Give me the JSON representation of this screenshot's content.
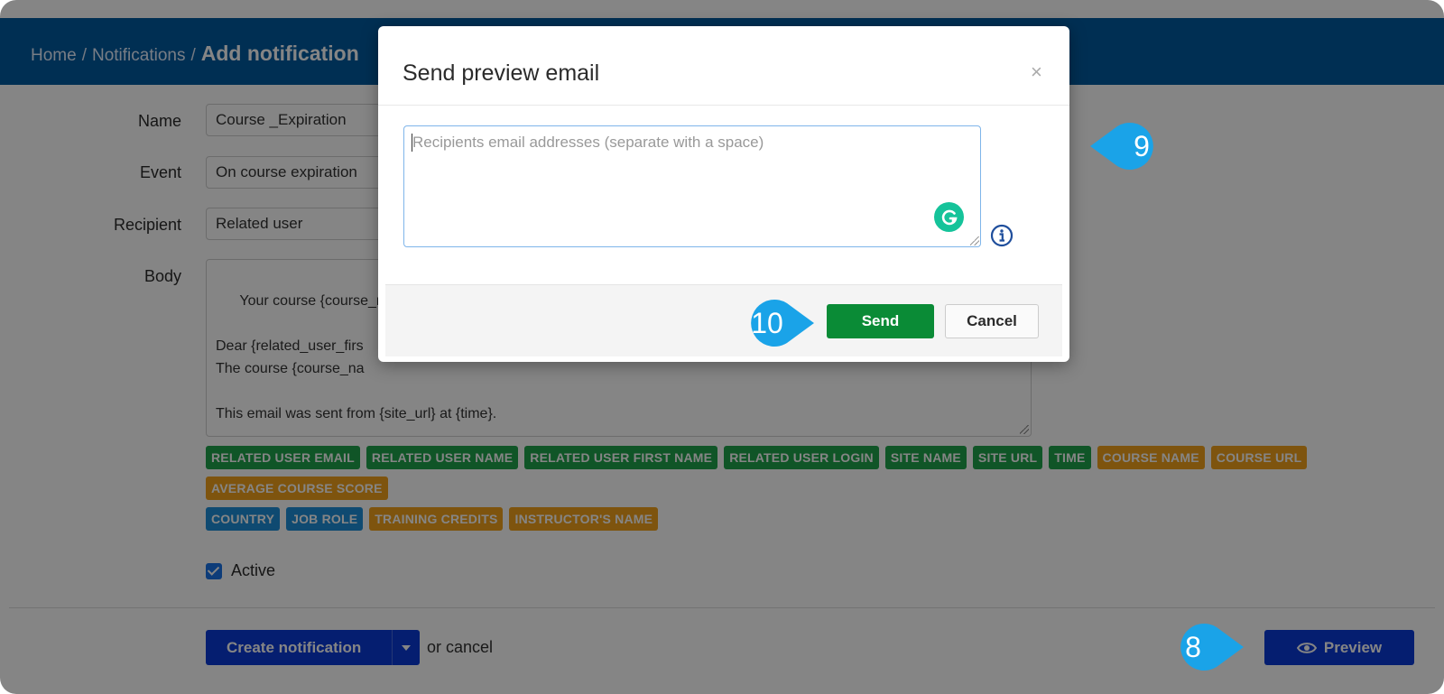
{
  "breadcrumb": {
    "home": "Home",
    "sep1": "/",
    "notifications": "Notifications",
    "sep2": "/",
    "current": "Add notification"
  },
  "form": {
    "name_label": "Name",
    "name_value": "Course _Expiration",
    "event_label": "Event",
    "event_value": "On course expiration",
    "recipient_label": "Recipient",
    "recipient_value": "Related user",
    "body_label": "Body",
    "body_text": "Your course {course_na\n\nDear {related_user_firs\nThe course {course_na\n\nThis email was sent from {site_url} at {time}."
  },
  "tags": {
    "row1": [
      {
        "label": "RELATED USER EMAIL",
        "color": "green"
      },
      {
        "label": "RELATED USER NAME",
        "color": "green"
      },
      {
        "label": "RELATED USER FIRST NAME",
        "color": "green"
      },
      {
        "label": "RELATED USER LOGIN",
        "color": "green"
      },
      {
        "label": "SITE NAME",
        "color": "green"
      },
      {
        "label": "SITE URL",
        "color": "green"
      },
      {
        "label": "TIME",
        "color": "green"
      },
      {
        "label": "COURSE NAME",
        "color": "orange"
      },
      {
        "label": "COURSE URL",
        "color": "orange"
      }
    ],
    "row2": [
      {
        "label": "AVERAGE COURSE SCORE",
        "color": "orange"
      }
    ],
    "row3": [
      {
        "label": "COUNTRY",
        "color": "blue"
      },
      {
        "label": "JOB ROLE",
        "color": "blue"
      },
      {
        "label": "TRAINING CREDITS",
        "color": "orange"
      },
      {
        "label": "INSTRUCTOR'S NAME",
        "color": "orange"
      }
    ]
  },
  "active": {
    "label": "Active",
    "checked": true
  },
  "footer": {
    "create_label": "Create notification",
    "or_cancel": "or cancel",
    "preview_label": "Preview"
  },
  "modal": {
    "title": "Send preview email",
    "close_glyph": "×",
    "recipients_placeholder": "Recipients email addresses (separate with a space)",
    "recipients_value": "",
    "send_label": "Send",
    "cancel_label": "Cancel"
  },
  "callouts": {
    "step8": "8",
    "step9": "9",
    "step10": "10",
    "color": "#1aa3e8"
  },
  "colors": {
    "topbar": "#005aa0",
    "primary_button": "#0b3bd6",
    "send_button": "#0a8b36",
    "tag_green": "#1fa34b",
    "tag_orange": "#f2a21b",
    "tag_blue": "#1e8fd9",
    "grammarly": "#15c39a"
  },
  "icons": {
    "close": "close-icon",
    "grammarly": "grammarly-icon",
    "info": "info-icon",
    "eye": "eye-icon",
    "caret": "caret-down-icon",
    "checkbox": "checkbox-checked-icon"
  }
}
